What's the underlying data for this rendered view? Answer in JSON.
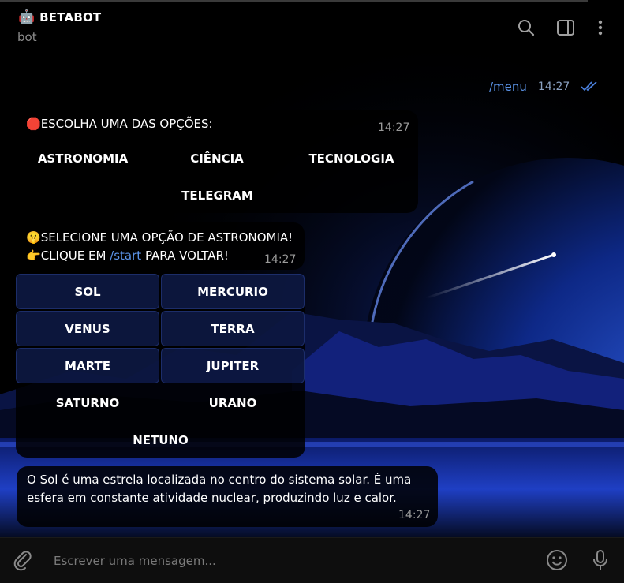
{
  "header": {
    "title": "BETABOT",
    "subtitle": "bot",
    "icons": [
      "robot-icon",
      "search-icon",
      "sidebar-toggle-icon",
      "more-vertical-icon"
    ]
  },
  "outgoing": {
    "text": "/menu",
    "time": "14:27",
    "status_icon": "double-check-icon"
  },
  "message1": {
    "emoji": "🛑",
    "text": "ESCOLHA UMA DAS OPÇÕES:",
    "time": "14:27",
    "buttons": [
      "ASTRONOMIA",
      "CIÊNCIA",
      "TECNOLOGIA",
      "TELEGRAM"
    ]
  },
  "message2": {
    "emoji1": "🤫",
    "line1": "SELECIONE UMA OPÇÃO DE ASTRONOMIA!",
    "emoji2": "👉",
    "line2_prefix": "CLIQUE EM ",
    "line2_link": "/start",
    "line2_suffix": " PARA VOLTAR!",
    "time": "14:27",
    "buttons": [
      "SOL",
      "MERCURIO",
      "VENUS",
      "TERRA",
      "MARTE",
      "JUPITER",
      "SATURNO",
      "URANO",
      "NETUNO"
    ]
  },
  "message3": {
    "line1": "O Sol é uma estrela localizada no centro do sistema solar. É uma",
    "line2": "esfera em constante atividade nuclear, produzindo luz e calor.",
    "time": "14:27"
  },
  "input": {
    "placeholder": "Escrever uma mensagem...",
    "value": ""
  },
  "colors": {
    "link": "#5a92e6",
    "background": "#000000",
    "button_glass": "#16286e"
  }
}
